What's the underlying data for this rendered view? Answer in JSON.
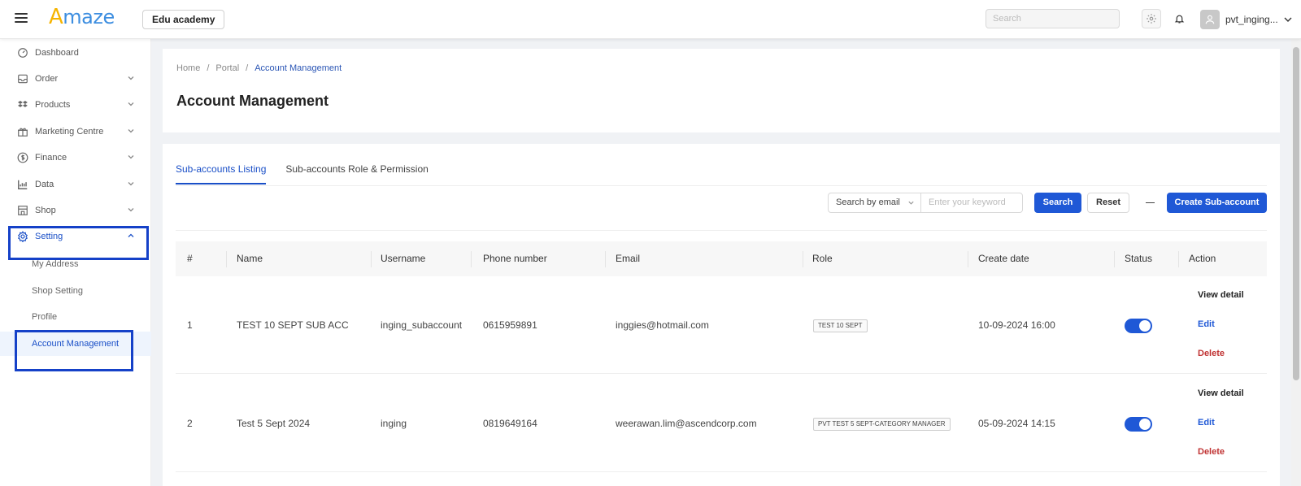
{
  "header": {
    "logo": {
      "prefix": "A",
      "rest": "maze"
    },
    "store_name": "Edu academy",
    "search_placeholder": "Search",
    "username": "pvt_inging..."
  },
  "sidebar": {
    "items": [
      {
        "label": "Dashboard",
        "icon": "dashboard-icon"
      },
      {
        "label": "Order",
        "icon": "inbox-icon"
      },
      {
        "label": "Products",
        "icon": "boxes-icon"
      },
      {
        "label": "Marketing Centre",
        "icon": "gift-icon"
      },
      {
        "label": "Finance",
        "icon": "dollar-icon"
      },
      {
        "label": "Data",
        "icon": "chart-icon"
      },
      {
        "label": "Shop",
        "icon": "shop-icon"
      },
      {
        "label": "Setting",
        "icon": "gear-icon"
      }
    ],
    "sub_items": [
      {
        "label": "My Address"
      },
      {
        "label": "Shop Setting"
      },
      {
        "label": "Profile"
      },
      {
        "label": "Account Management"
      }
    ]
  },
  "breadcrumb": {
    "home": "Home",
    "sep": "/",
    "portal": "Portal",
    "current": "Account Management"
  },
  "page_title": "Account Management",
  "tabs": [
    {
      "label": "Sub-accounts Listing"
    },
    {
      "label": "Sub-accounts Role & Permission"
    }
  ],
  "filter": {
    "select_value": "Search by email",
    "input_placeholder": "Enter your keyword",
    "search_label": "Search",
    "reset_label": "Reset",
    "create_label": "Create Sub-account"
  },
  "table": {
    "columns": [
      "#",
      "Name",
      "Username",
      "Phone number",
      "Email",
      "Role",
      "Create date",
      "Status",
      "Action"
    ],
    "rows": [
      {
        "no": "1",
        "name": "TEST 10 SEPT SUB ACC",
        "username": "inging_subaccount",
        "phone": "0615959891",
        "email": "inggies@hotmail.com",
        "role": "TEST 10 SEPT",
        "date": "10-09-2024 16:00",
        "status": "on"
      },
      {
        "no": "2",
        "name": "Test 5 Sept 2024",
        "username": "inging",
        "phone": "0819649164",
        "email": "weerawan.lim@ascendcorp.com",
        "role": "PVT TEST 5 SEPT-CATEGORY MANAGER",
        "date": "05-09-2024 14:15",
        "status": "on"
      }
    ],
    "actions": {
      "view": "View detail",
      "edit": "Edit",
      "delete": "Delete"
    }
  },
  "colors": {
    "accent": "#1f58d6",
    "highlight": "#1541c8",
    "danger": "#c03333"
  }
}
